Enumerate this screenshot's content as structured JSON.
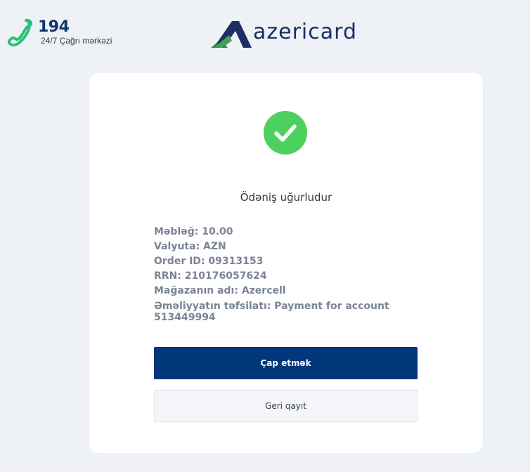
{
  "header": {
    "call_center_number": "194",
    "call_center_label": "24/7 Çağrı mərkəzi",
    "logo_text": "azericard"
  },
  "receipt": {
    "status_title": "Ödəniş uğurludur",
    "details": [
      {
        "label": "Məbləğ",
        "value": "10.00"
      },
      {
        "label": "Valyuta",
        "value": "AZN"
      },
      {
        "label": "Order ID",
        "value": "09313153"
      },
      {
        "label": "RRN",
        "value": "210176057624"
      },
      {
        "label": "Mağazanın adı",
        "value": "Azercell"
      }
    ],
    "operation_details_line1": "Əməliyyatın təfsilatı: Payment for account",
    "operation_details_line2": "513449994"
  },
  "actions": {
    "print_label": "Çap etmək",
    "back_label": "Geri qayıt"
  },
  "colors": {
    "background": "#eef1f6",
    "primary_button": "#00367a",
    "success_green": "#4cd05e",
    "brand_navy": "#1b2f62",
    "brand_green": "#2f8a46",
    "detail_text": "#7a8494"
  },
  "icons": {
    "phone": "phone-icon",
    "success": "checkmark-circle-icon",
    "logo": "azericard-logo-icon"
  }
}
